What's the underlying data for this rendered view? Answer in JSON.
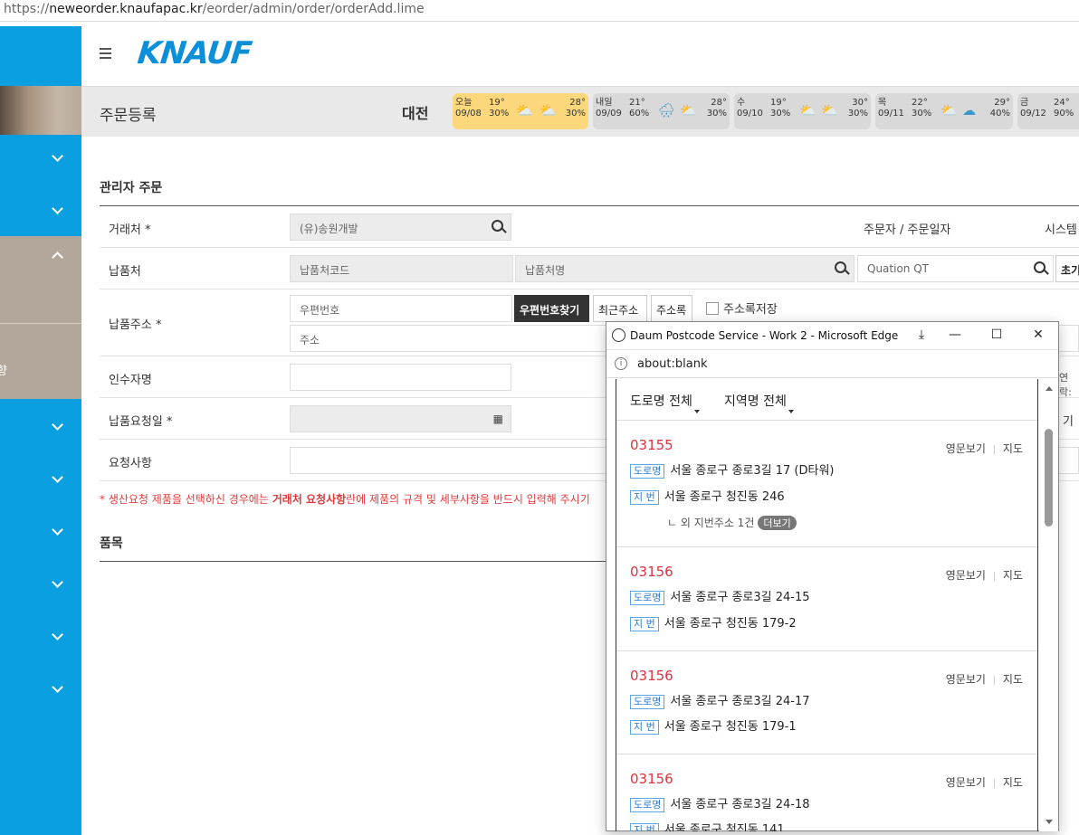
{
  "browser": {
    "url_scheme": "https://",
    "url_host": "neweorder.knaufapac.kr",
    "url_path": "/eorder/admin/order/orderAdd.lime"
  },
  "header": {
    "logo": "KNAUF",
    "page_title": "주문등록",
    "city": "대전"
  },
  "weather": [
    {
      "day": "오늘",
      "date": "09/08",
      "low": "19°",
      "low_rain": "30%",
      "high": "28°",
      "high_rain": "30%",
      "today": true
    },
    {
      "day": "내일",
      "date": "09/09",
      "low": "21°",
      "low_rain": "60%",
      "high": "28°",
      "high_rain": "30%",
      "today": false
    },
    {
      "day": "수",
      "date": "09/10",
      "low": "19°",
      "low_rain": "30%",
      "high": "30°",
      "high_rain": "30%",
      "today": false
    },
    {
      "day": "목",
      "date": "09/11",
      "low": "22°",
      "low_rain": "30%",
      "high": "29°",
      "high_rain": "40%",
      "today": false
    },
    {
      "day": "금",
      "date": "09/12",
      "low": "24°",
      "low_rain": "90%",
      "high": "",
      "high_rain": "",
      "today": false
    }
  ],
  "sidebar": {
    "active_sub_label": "향"
  },
  "form": {
    "section_title": "관리자 주문",
    "customer_label": "거래처 *",
    "customer_value": "(유)송원개발",
    "orderer_label": "주문자 / 주문일자",
    "system_label": "시스템",
    "delivery_label": "납품처",
    "delivery_code_placeholder": "납품처코드",
    "delivery_name_placeholder": "납품처명",
    "quotation_placeholder": "Quation QT",
    "reset_button": "초기",
    "address_label": "납품주소 *",
    "zipcode_placeholder": "우편번호",
    "find_zip_button": "우편번호찾기",
    "recent_address_button": "최근주소",
    "address_book_button": "주소록",
    "save_address_label": "주소록저장",
    "address_placeholder": "주소",
    "receiver_label": "인수자명",
    "contact_label_partial": "연락:",
    "request_date_label": "납품요청일 *",
    "right_partial": "기",
    "request_label": "요청사항",
    "note_prefix": "* 생산요청 제품을 선택하신 경우에는 ",
    "note_bold": "거래처 요청사항",
    "note_suffix": "란에 제품의 규격 및 세부사항을 반드시 입력해 주시기",
    "items_title": "품목"
  },
  "popup": {
    "window_title": "Daum Postcode Service - Work 2 - Microsoft Edge",
    "address_bar": "about:blank",
    "tab_road": "도로명 전체",
    "tab_region": "지역명 전체",
    "english_link": "영문보기",
    "map_link": "지도",
    "road_tag": "도로명",
    "lot_tag": "지 번",
    "results": [
      {
        "zip": "03155",
        "road": "서울 종로구 종로3길 17 (D타워)",
        "lot": "서울 종로구 청진동 246",
        "extra": "ㄴ 외 지번주소 1건",
        "extra_button": "더보기"
      },
      {
        "zip": "03156",
        "road": "서울 종로구 종로3길 24-15",
        "lot": "서울 종로구 청진동 179-2"
      },
      {
        "zip": "03156",
        "road": "서울 종로구 종로3길 24-17",
        "lot": "서울 종로구 청진동 179-1"
      },
      {
        "zip": "03156",
        "road": "서울 종로구 종로3길 24-18",
        "lot": "서울 종로구 청진동 141"
      }
    ]
  }
}
